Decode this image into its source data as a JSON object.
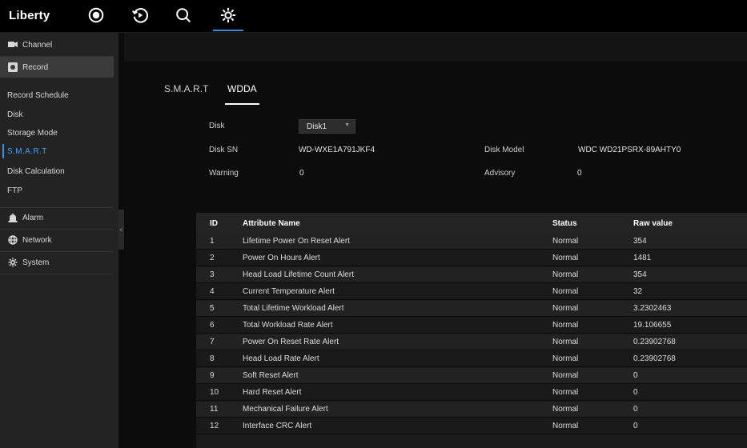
{
  "app": {
    "title": "Liberty"
  },
  "topnav": [
    {
      "name": "live-view-icon"
    },
    {
      "name": "playback-icon"
    },
    {
      "name": "search-icon"
    },
    {
      "name": "settings-icon",
      "active": true
    }
  ],
  "sidebar": {
    "groups": [
      {
        "label": "Channel",
        "icon": "camera-icon"
      },
      {
        "label": "Record",
        "icon": "record-icon",
        "selected": true
      },
      {
        "label": "Alarm",
        "icon": "alarm-icon"
      },
      {
        "label": "Network",
        "icon": "network-icon"
      },
      {
        "label": "System",
        "icon": "system-gear-icon"
      }
    ],
    "record_items": [
      {
        "label": "Record Schedule"
      },
      {
        "label": "Disk"
      },
      {
        "label": "Storage Mode"
      },
      {
        "label": "S.M.A.R.T",
        "selected": true
      },
      {
        "label": "Disk Calculation"
      },
      {
        "label": "FTP"
      }
    ],
    "collapse_glyph": "<"
  },
  "tabs": [
    {
      "label": "S.M.A.R.T",
      "active": false
    },
    {
      "label": "WDDA",
      "active": true
    }
  ],
  "disk_info": {
    "disk_label": "Disk",
    "disk_value": "Disk1",
    "disk_sn_label": "Disk SN",
    "disk_sn_value": "WD-WXE1A791JKF4",
    "disk_model_label": "Disk Model",
    "disk_model_value": "WDC WD21PSRX-89AHTY0",
    "warning_label": "Warning",
    "warning_value": "0",
    "advisory_label": "Advisory",
    "advisory_value": "0"
  },
  "table": {
    "headers": [
      "ID",
      "Attribute Name",
      "Status",
      "Raw value"
    ],
    "rows": [
      {
        "id": "1",
        "name": "Lifetime Power On Reset Alert",
        "status": "Normal",
        "raw": "354"
      },
      {
        "id": "2",
        "name": "Power On Hours Alert",
        "status": "Normal",
        "raw": "1481"
      },
      {
        "id": "3",
        "name": "Head Load Lifetime Count Alert",
        "status": "Normal",
        "raw": "354"
      },
      {
        "id": "4",
        "name": "Current Temperature Alert",
        "status": "Normal",
        "raw": "32"
      },
      {
        "id": "5",
        "name": "Total Lifetime Workload Alert",
        "status": "Normal",
        "raw": "3.2302463"
      },
      {
        "id": "6",
        "name": "Total Workload Rate Alert",
        "status": "Normal",
        "raw": "19.106655"
      },
      {
        "id": "7",
        "name": "Power On Reset Rate Alert",
        "status": "Normal",
        "raw": "0.23902768"
      },
      {
        "id": "8",
        "name": "Head Load Rate Alert",
        "status": "Normal",
        "raw": "0.23902768"
      },
      {
        "id": "9",
        "name": "Soft Reset Alert",
        "status": "Normal",
        "raw": "0"
      },
      {
        "id": "10",
        "name": "Hard Reset Alert",
        "status": "Normal",
        "raw": "0"
      },
      {
        "id": "11",
        "name": "Mechanical Failure Alert",
        "status": "Normal",
        "raw": "0"
      },
      {
        "id": "12",
        "name": "Interface CRC Alert",
        "status": "Normal",
        "raw": "0"
      }
    ]
  },
  "colors": {
    "accent": "#3c8de0",
    "background": "#0b0b0b",
    "sidebar": "#232323"
  }
}
